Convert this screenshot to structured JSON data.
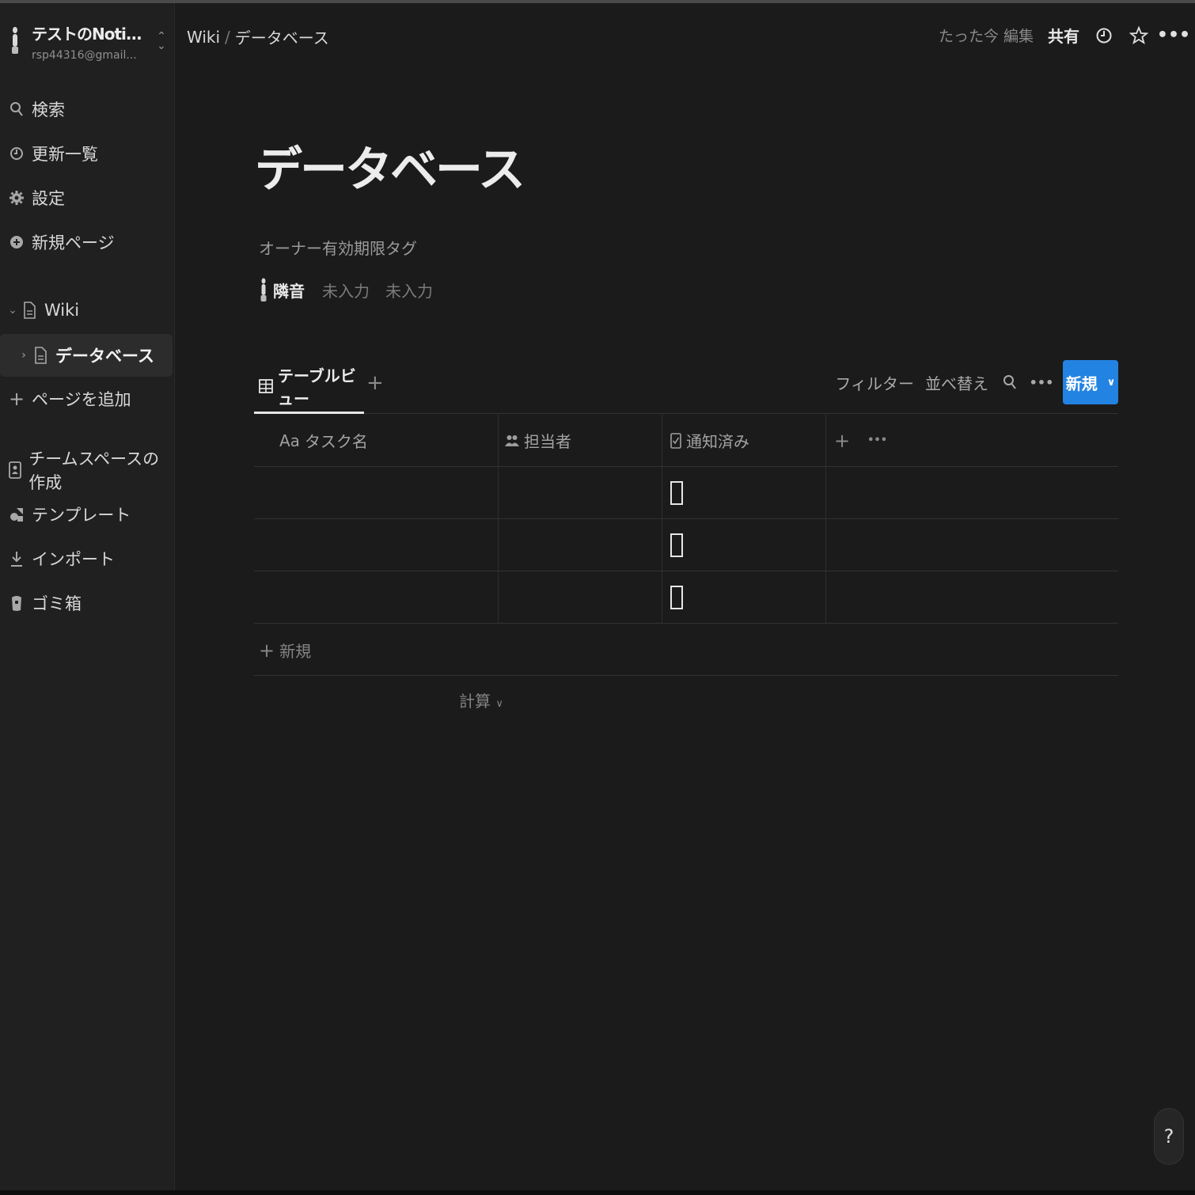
{
  "sidebar": {
    "workspace_name": "テストのNoti...",
    "workspace_email": "rsp44316@gmail...",
    "nav": [
      {
        "label": "検索",
        "icon": "search-icon"
      },
      {
        "label": "更新一覧",
        "icon": "clock-icon"
      },
      {
        "label": "設定",
        "icon": "gear-icon"
      },
      {
        "label": "新規ページ",
        "icon": "plus-circle-icon"
      }
    ],
    "tree": [
      {
        "label": "Wiki",
        "icon": "page-icon",
        "expanded": true
      },
      {
        "label": "データベース",
        "icon": "page-icon",
        "selected": true
      }
    ],
    "add_page": "ページを追加",
    "bottom": [
      {
        "label": "チームスペースの作成",
        "icon": "teamspace-icon"
      },
      {
        "label": "テンプレート",
        "icon": "template-icon"
      },
      {
        "label": "インポート",
        "icon": "download-icon"
      },
      {
        "label": "ゴミ箱",
        "icon": "trash-icon"
      }
    ]
  },
  "header": {
    "crumbs": [
      "Wiki",
      "データベース"
    ],
    "edited": "たった今 編集",
    "share": "共有"
  },
  "page": {
    "title": "データベース",
    "props": {
      "labels": [
        "オーナー",
        "有効期限",
        "タグ"
      ],
      "owner": "隣音",
      "due": "未入力",
      "tag": "未入力"
    }
  },
  "view": {
    "tab": "テーブルビュー",
    "filter": "フィルター",
    "sort": "並べ替え",
    "new": "新規"
  },
  "table": {
    "columns": [
      {
        "prefix": "Aa",
        "label": "タスク名"
      },
      {
        "label": "担当者"
      },
      {
        "label": "通知済み"
      }
    ],
    "rows": [
      {
        "task": "",
        "assignee": "",
        "notified": false
      },
      {
        "task": "",
        "assignee": "",
        "notified": false
      },
      {
        "task": "",
        "assignee": "",
        "notified": false
      }
    ],
    "add_row": "新規",
    "calc": "計算"
  },
  "help": "?",
  "colors": {
    "background": "#1b1b1b",
    "sidebar": "#202020",
    "accent": "#2383e2"
  }
}
